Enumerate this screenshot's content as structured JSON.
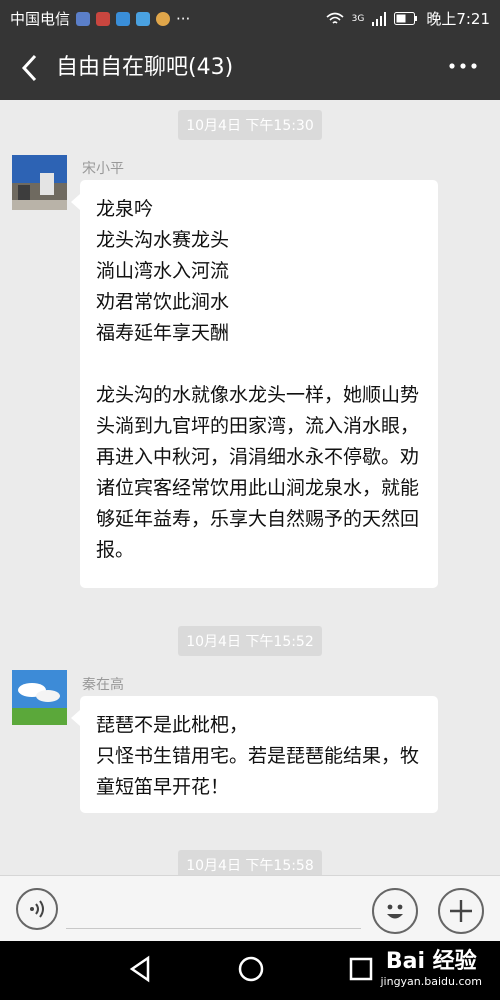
{
  "status_bar": {
    "carrier": "中国电信",
    "ellipsis": "···",
    "time": "晚上7:21",
    "network": "3G"
  },
  "header": {
    "title": "自由自在聊吧(43)",
    "back_icon": "chevron-left-icon",
    "more_icon": "more-dots-icon"
  },
  "messages": [
    {
      "time": "10月4日 下午15:30",
      "sender": "宋小平",
      "text": "龙泉吟\n龙头沟水赛龙头\n淌山湾水入河流\n劝君常饮此涧水\n福寿延年享天酬\n\n龙头沟的水就像水龙头一样，她顺山势头淌到九官坪的田家湾，流入消水眼，再进入中秋河，涓涓细水永不停歇。劝诸位宾客经常饮用此山涧龙泉水，就能够延年益寿，乐享大自然赐予的天然回报。"
    },
    {
      "time": "10月4日 下午15:52",
      "sender": "秦在高",
      "text": "琵琶不是此枇杷，\n只怪书生错用宅。若是琵琶能结果，牧童短笛早开花！"
    },
    {
      "time": "10月4日 下午15:58"
    }
  ],
  "watermark": {
    "brand": "Bai  经验",
    "url": "jingyan.baidu.com"
  },
  "colors": {
    "header_bg": "#353535",
    "chat_bg": "#ebebeb",
    "bubble_bg": "#ffffff",
    "time_badge_bg": "#dadada"
  }
}
